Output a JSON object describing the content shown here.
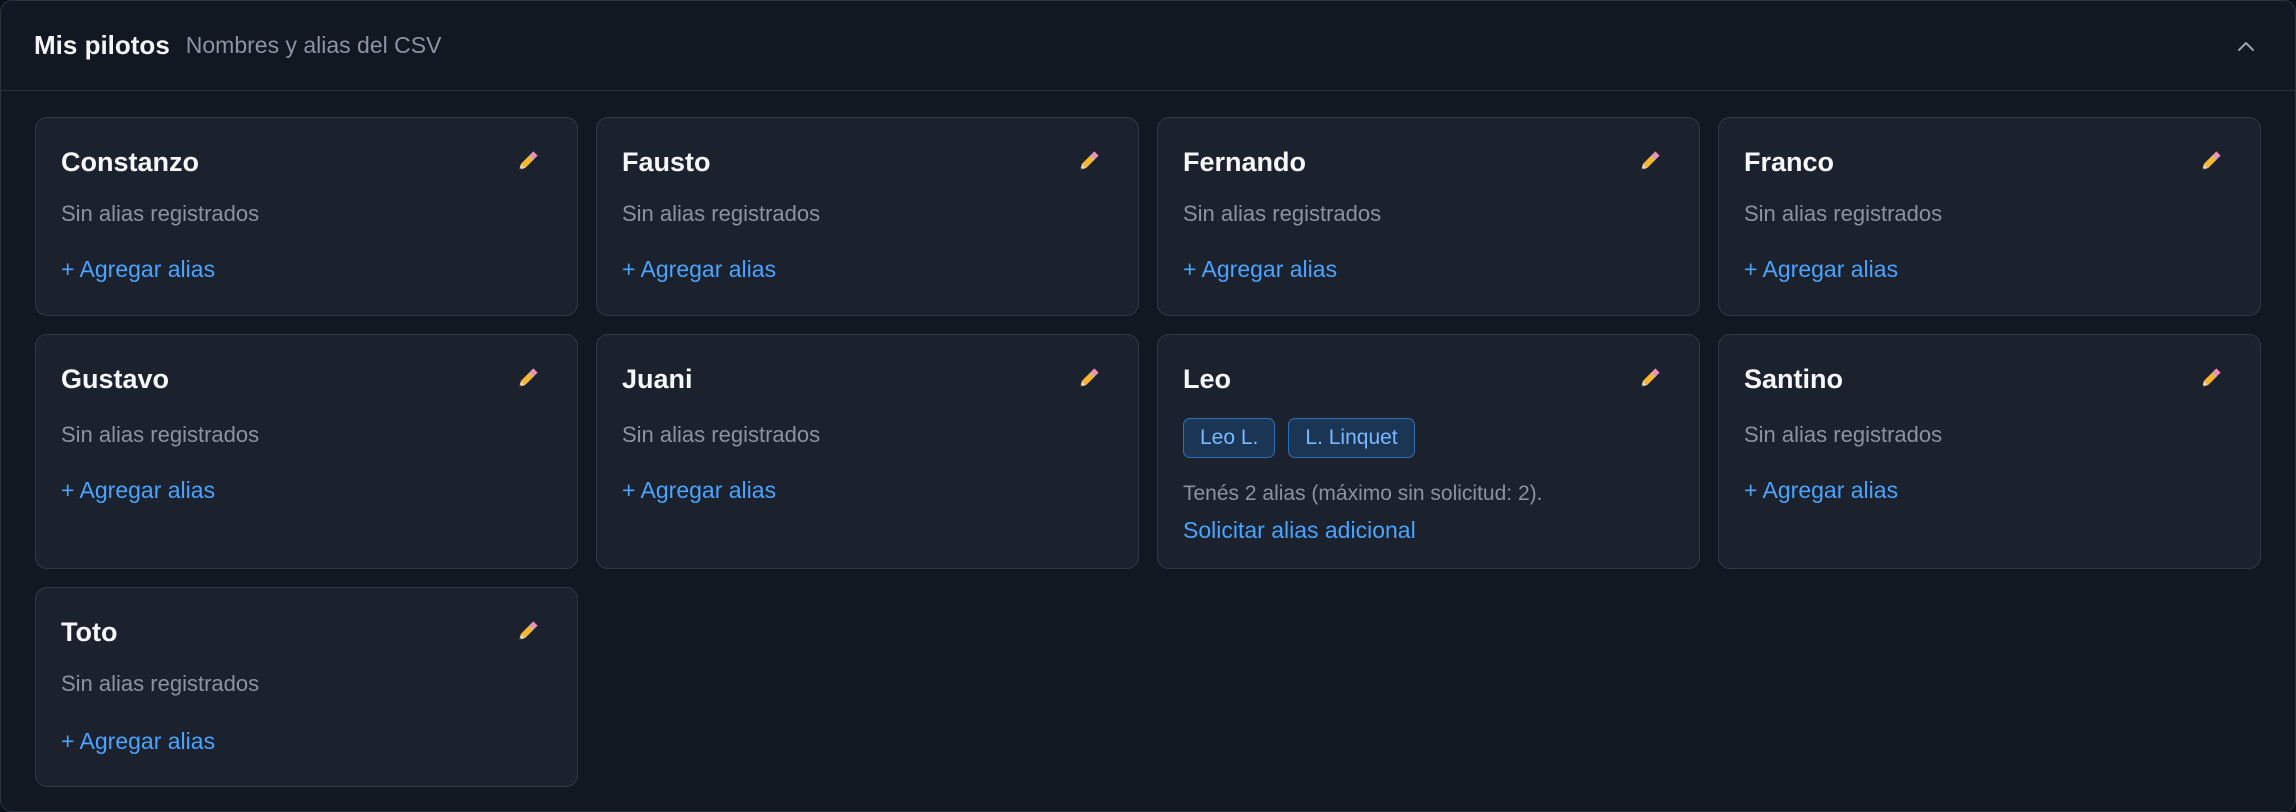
{
  "header": {
    "title": "Mis pilotos",
    "subtitle": "Nombres y alias del CSV"
  },
  "icons": {
    "edit": "pencil-icon",
    "collapse": "chevron-up-icon"
  },
  "colors": {
    "accent": "#4aa3ff",
    "card_bg": "#1c222d",
    "panel_bg": "#111821"
  },
  "pilots": [
    {
      "name": "Constanzo",
      "no_alias": "Sin alias registrados",
      "add_alias": "+ Agregar alias"
    },
    {
      "name": "Fausto",
      "no_alias": "Sin alias registrados",
      "add_alias": "+ Agregar alias"
    },
    {
      "name": "Fernando",
      "no_alias": "Sin alias registrados",
      "add_alias": "+ Agregar alias"
    },
    {
      "name": "Franco",
      "no_alias": "Sin alias registrados",
      "add_alias": "+ Agregar alias"
    },
    {
      "name": "Gustavo",
      "no_alias": "Sin alias registrados",
      "add_alias": "+ Agregar alias"
    },
    {
      "name": "Juani",
      "no_alias": "Sin alias registrados",
      "add_alias": "+ Agregar alias"
    },
    {
      "name": "Leo",
      "aliases": [
        "Leo L.",
        "L. Linquet"
      ],
      "alias_count_text": "Tenés 2 alias (máximo sin solicitud: 2).",
      "request_alias": "Solicitar alias adicional"
    },
    {
      "name": "Santino",
      "no_alias": "Sin alias registrados",
      "add_alias": "+ Agregar alias"
    },
    {
      "name": "Toto",
      "no_alias": "Sin alias registrados",
      "add_alias": "+ Agregar alias"
    }
  ]
}
